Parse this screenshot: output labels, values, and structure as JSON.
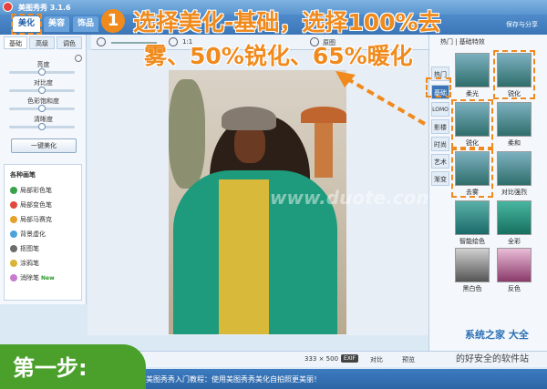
{
  "window": {
    "title": "美图秀秀 3.1.6"
  },
  "nav": {
    "tabs": [
      "美化",
      "美容",
      "饰品"
    ],
    "share": "保存与分享"
  },
  "toolbar": {
    "ratio": "1:1",
    "pan": "原图"
  },
  "left_panel": {
    "subtabs": [
      "基础",
      "高级",
      "调色"
    ],
    "sliders": [
      {
        "label": "亮度",
        "value": 0.5
      },
      {
        "label": "对比度",
        "value": 0.5
      },
      {
        "label": "色彩饱和度",
        "value": 0.5
      },
      {
        "label": "清晰度",
        "value": 0.5
      }
    ],
    "oneclick": "一键美化",
    "brush_title": "各种画笔",
    "brushes": [
      {
        "label": "局部彩色笔",
        "color": "#3aa34a"
      },
      {
        "label": "局部变色笔",
        "color": "#e0483a"
      },
      {
        "label": "局部马赛克",
        "color": "#e6a12a"
      },
      {
        "label": "背景虚化",
        "color": "#4aa3d9"
      },
      {
        "label": "抠图笔",
        "color": "#6d6d6d"
      },
      {
        "label": "涂鸦笔",
        "color": "#d9b43a"
      },
      {
        "label": "消除笔",
        "color": "#c77bd1"
      }
    ],
    "new_badge": "New"
  },
  "status": {
    "size": "333 × 500",
    "exif": "EXIF",
    "compare": "对比",
    "preview": "预览"
  },
  "bottom": {
    "tip": "美图秀秀入门教程：使用美图秀秀美化自拍照更美丽！"
  },
  "step": {
    "label": "第一步:"
  },
  "instruction": {
    "number": "1",
    "line1": "选择美化-基础，选择100%去",
    "line2": "雾、50%锐化、65%暖化"
  },
  "right_panel": {
    "header": "热门 | 基础特效",
    "vtabs": [
      "热门",
      "基础",
      "LOMO",
      "影楼",
      "时尚",
      "艺术",
      "渐变"
    ],
    "effects": [
      "柔光",
      "锐化",
      "锐化",
      "柔和",
      "去雾",
      "对比强烈",
      "智能绘色",
      "全彩",
      "黑白色",
      "反色"
    ]
  },
  "watermark": "www.duote.com",
  "corner_logo": {
    "line1": "系统之家 大全",
    "line2": "的好安全的软件站"
  }
}
